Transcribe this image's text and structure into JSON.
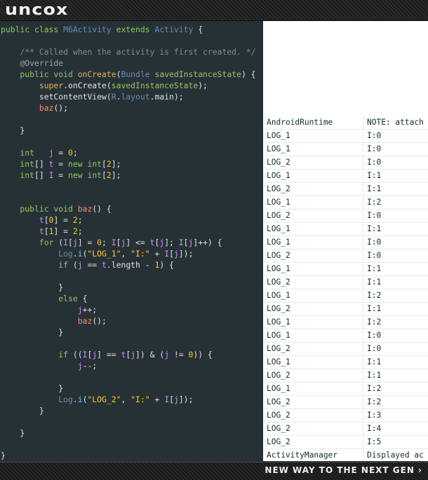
{
  "header": {
    "logo_text": "uncox"
  },
  "footer": {
    "slogan": "NEW WAY TO THE NEXT GEN ›"
  },
  "code": {
    "lines": [
      [
        {
          "t": "public class ",
          "c": "kw"
        },
        {
          "t": "M6Activity",
          "c": "cls"
        },
        {
          "t": " extends ",
          "c": "kw"
        },
        {
          "t": "Activity",
          "c": "cls"
        },
        {
          "t": " {",
          "c": ""
        }
      ],
      [],
      [
        {
          "t": "    /** Called when the activity is first created. */",
          "c": "cmt"
        }
      ],
      [
        {
          "t": "    @Override",
          "c": "ann"
        }
      ],
      [
        {
          "t": "    public void ",
          "c": "kw"
        },
        {
          "t": "onCreate",
          "c": "fn"
        },
        {
          "t": "(",
          "c": ""
        },
        {
          "t": "Bundle",
          "c": "cls"
        },
        {
          "t": " ",
          "c": ""
        },
        {
          "t": "savedInstanceState",
          "c": "kw"
        },
        {
          "t": ") {",
          "c": ""
        }
      ],
      [
        {
          "t": "        super",
          "c": "fn"
        },
        {
          "t": ".onCreate(",
          "c": ""
        },
        {
          "t": "savedInstanceState",
          "c": "kw"
        },
        {
          "t": ");",
          "c": ""
        }
      ],
      [
        {
          "t": "        setContentView(",
          "c": ""
        },
        {
          "t": "R",
          "c": "cls"
        },
        {
          "t": ".",
          "c": ""
        },
        {
          "t": "layout",
          "c": "cls"
        },
        {
          "t": ".main);",
          "c": ""
        }
      ],
      [
        {
          "t": "        baz",
          "c": "red"
        },
        {
          "t": "();",
          "c": ""
        }
      ],
      [],
      [
        {
          "t": "    }",
          "c": ""
        }
      ],
      [],
      [
        {
          "t": "    int",
          "c": "kw"
        },
        {
          "t": "   ",
          "c": ""
        },
        {
          "t": "j",
          "c": "var"
        },
        {
          "t": " = ",
          "c": ""
        },
        {
          "t": "0",
          "c": "num"
        },
        {
          "t": ";",
          "c": ""
        }
      ],
      [
        {
          "t": "    int",
          "c": "kw"
        },
        {
          "t": "[] ",
          "c": ""
        },
        {
          "t": "t",
          "c": "var"
        },
        {
          "t": " = ",
          "c": ""
        },
        {
          "t": "new int",
          "c": "kw"
        },
        {
          "t": "[",
          "c": ""
        },
        {
          "t": "2",
          "c": "num"
        },
        {
          "t": "];",
          "c": ""
        }
      ],
      [
        {
          "t": "    int",
          "c": "kw"
        },
        {
          "t": "[] ",
          "c": ""
        },
        {
          "t": "I",
          "c": "var"
        },
        {
          "t": " = ",
          "c": ""
        },
        {
          "t": "new int",
          "c": "kw"
        },
        {
          "t": "[",
          "c": ""
        },
        {
          "t": "2",
          "c": "num"
        },
        {
          "t": "];",
          "c": ""
        }
      ],
      [],
      [],
      [
        {
          "t": "    public void ",
          "c": "kw"
        },
        {
          "t": "baz",
          "c": "red"
        },
        {
          "t": "() {",
          "c": ""
        }
      ],
      [
        {
          "t": "        t",
          "c": "var"
        },
        {
          "t": "[",
          "c": ""
        },
        {
          "t": "0",
          "c": "num"
        },
        {
          "t": "] = ",
          "c": ""
        },
        {
          "t": "2",
          "c": "num"
        },
        {
          "t": ";",
          "c": ""
        }
      ],
      [
        {
          "t": "        t",
          "c": "var"
        },
        {
          "t": "[",
          "c": ""
        },
        {
          "t": "1",
          "c": "num"
        },
        {
          "t": "] = ",
          "c": ""
        },
        {
          "t": "2",
          "c": "num"
        },
        {
          "t": ";",
          "c": ""
        }
      ],
      [
        {
          "t": "        for ",
          "c": "kw"
        },
        {
          "t": "(",
          "c": ""
        },
        {
          "t": "I",
          "c": "var"
        },
        {
          "t": "[",
          "c": ""
        },
        {
          "t": "j",
          "c": "var"
        },
        {
          "t": "] = ",
          "c": ""
        },
        {
          "t": "0",
          "c": "num"
        },
        {
          "t": "; ",
          "c": ""
        },
        {
          "t": "I",
          "c": "var"
        },
        {
          "t": "[",
          "c": ""
        },
        {
          "t": "j",
          "c": "var"
        },
        {
          "t": "] <= ",
          "c": ""
        },
        {
          "t": "t",
          "c": "var"
        },
        {
          "t": "[",
          "c": ""
        },
        {
          "t": "j",
          "c": "var"
        },
        {
          "t": "]; ",
          "c": ""
        },
        {
          "t": "I",
          "c": "var"
        },
        {
          "t": "[",
          "c": ""
        },
        {
          "t": "j",
          "c": "var"
        },
        {
          "t": "]++) {",
          "c": ""
        }
      ],
      [
        {
          "t": "            Log",
          "c": "cls"
        },
        {
          "t": ".",
          "c": ""
        },
        {
          "t": "i",
          "c": "cyan"
        },
        {
          "t": "(",
          "c": ""
        },
        {
          "t": "\"LOG_1\"",
          "c": "str"
        },
        {
          "t": ", ",
          "c": ""
        },
        {
          "t": "\"I:\"",
          "c": "str"
        },
        {
          "t": " + ",
          "c": ""
        },
        {
          "t": "I",
          "c": "var"
        },
        {
          "t": "[",
          "c": ""
        },
        {
          "t": "j",
          "c": "var"
        },
        {
          "t": "]);",
          "c": ""
        }
      ],
      [
        {
          "t": "            if ",
          "c": "kw"
        },
        {
          "t": "(",
          "c": ""
        },
        {
          "t": "j",
          "c": "var"
        },
        {
          "t": " == ",
          "c": ""
        },
        {
          "t": "t",
          "c": "var"
        },
        {
          "t": ".length - ",
          "c": ""
        },
        {
          "t": "1",
          "c": "num"
        },
        {
          "t": ") {",
          "c": ""
        }
      ],
      [],
      [
        {
          "t": "            }",
          "c": ""
        }
      ],
      [
        {
          "t": "            else ",
          "c": "kw"
        },
        {
          "t": "{",
          "c": ""
        }
      ],
      [
        {
          "t": "                j",
          "c": "var"
        },
        {
          "t": "++;",
          "c": ""
        }
      ],
      [
        {
          "t": "                baz",
          "c": "red"
        },
        {
          "t": "();",
          "c": ""
        }
      ],
      [
        {
          "t": "            }",
          "c": ""
        }
      ],
      [],
      [
        {
          "t": "            if ",
          "c": "kw"
        },
        {
          "t": "((",
          "c": ""
        },
        {
          "t": "I",
          "c": "var"
        },
        {
          "t": "[",
          "c": ""
        },
        {
          "t": "j",
          "c": "var"
        },
        {
          "t": "] == ",
          "c": ""
        },
        {
          "t": "t",
          "c": "var"
        },
        {
          "t": "[",
          "c": ""
        },
        {
          "t": "j",
          "c": "var"
        },
        {
          "t": "]) & (",
          "c": ""
        },
        {
          "t": "j",
          "c": "var"
        },
        {
          "t": " != ",
          "c": ""
        },
        {
          "t": "0",
          "c": "num"
        },
        {
          "t": ")) {",
          "c": ""
        }
      ],
      [
        {
          "t": "                j",
          "c": "var"
        },
        {
          "t": "--;",
          "c": ""
        }
      ],
      [],
      [
        {
          "t": "            }",
          "c": ""
        }
      ],
      [
        {
          "t": "            Log",
          "c": "cls"
        },
        {
          "t": ".",
          "c": ""
        },
        {
          "t": "i",
          "c": "cyan"
        },
        {
          "t": "(",
          "c": ""
        },
        {
          "t": "\"LOG_2\"",
          "c": "str"
        },
        {
          "t": ", ",
          "c": ""
        },
        {
          "t": "\"I:\"",
          "c": "str"
        },
        {
          "t": " + ",
          "c": ""
        },
        {
          "t": "I",
          "c": "var"
        },
        {
          "t": "[",
          "c": ""
        },
        {
          "t": "j",
          "c": "var"
        },
        {
          "t": "]);",
          "c": ""
        }
      ],
      [
        {
          "t": "        }",
          "c": ""
        }
      ],
      [],
      [
        {
          "t": "    }",
          "c": ""
        }
      ],
      [],
      [
        {
          "t": "}",
          "c": ""
        }
      ]
    ]
  },
  "logcat": {
    "rows": [
      {
        "tag": "AndroidRuntime",
        "msg": "NOTE: attach"
      },
      {
        "tag": "LOG_1",
        "msg": "I:0"
      },
      {
        "tag": "LOG_1",
        "msg": "I:0"
      },
      {
        "tag": "LOG_2",
        "msg": "I:0"
      },
      {
        "tag": "LOG_1",
        "msg": "I:1"
      },
      {
        "tag": "LOG_2",
        "msg": "I:1"
      },
      {
        "tag": "LOG_1",
        "msg": "I:2"
      },
      {
        "tag": "LOG_2",
        "msg": "I:0"
      },
      {
        "tag": "LOG_1",
        "msg": "I:1"
      },
      {
        "tag": "LOG_1",
        "msg": "I:0"
      },
      {
        "tag": "LOG_2",
        "msg": "I:0"
      },
      {
        "tag": "LOG_1",
        "msg": "I:1"
      },
      {
        "tag": "LOG_2",
        "msg": "I:1"
      },
      {
        "tag": "LOG_1",
        "msg": "I:2"
      },
      {
        "tag": "LOG_2",
        "msg": "I:1"
      },
      {
        "tag": "LOG_1",
        "msg": "I:2"
      },
      {
        "tag": "LOG_1",
        "msg": "I:0"
      },
      {
        "tag": "LOG_2",
        "msg": "I:0"
      },
      {
        "tag": "LOG_1",
        "msg": "I:1"
      },
      {
        "tag": "LOG_2",
        "msg": "I:1"
      },
      {
        "tag": "LOG_1",
        "msg": "I:2"
      },
      {
        "tag": "LOG_2",
        "msg": "I:2"
      },
      {
        "tag": "LOG_2",
        "msg": "I:3"
      },
      {
        "tag": "LOG_2",
        "msg": "I:4"
      },
      {
        "tag": "LOG_2",
        "msg": "I:5"
      },
      {
        "tag": "ActivityManager",
        "msg": "Displayed ac"
      }
    ]
  }
}
